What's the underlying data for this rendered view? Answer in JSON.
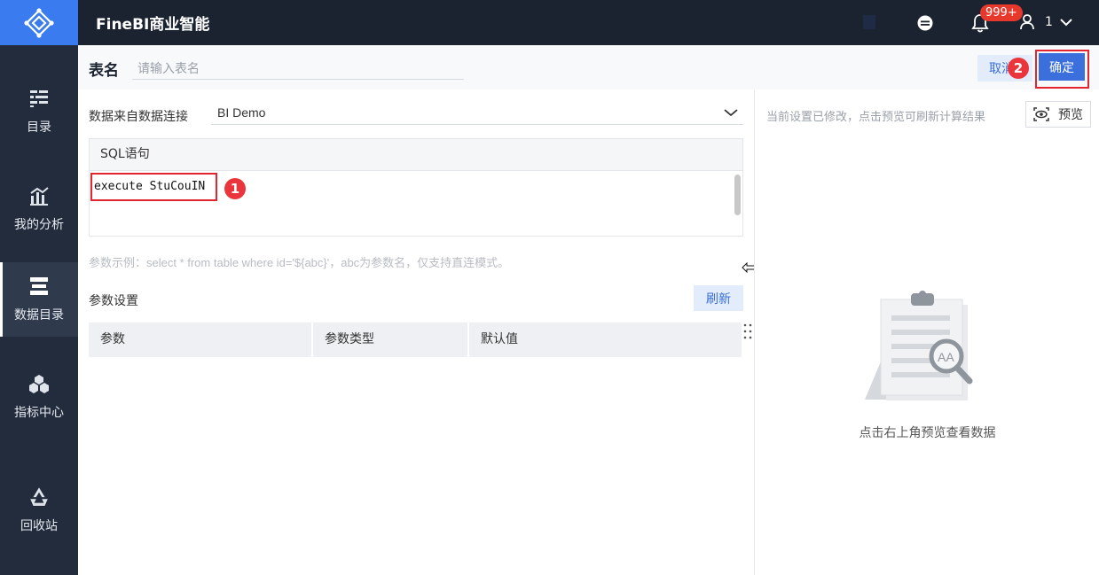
{
  "header": {
    "app_title": "FineBI商业智能",
    "notification_count": "999+",
    "user_name": "1"
  },
  "sidebar": {
    "items": [
      {
        "label": "目录",
        "icon": "list-icon",
        "active": false
      },
      {
        "label": "我的分析",
        "icon": "analysis-chart-icon",
        "active": false
      },
      {
        "label": "数据目录",
        "icon": "database-icon",
        "active": true
      },
      {
        "label": "指标中心",
        "icon": "cubes-icon",
        "active": false
      },
      {
        "label": "回收站",
        "icon": "recycle-icon",
        "active": false
      }
    ]
  },
  "toolbar": {
    "table_name_label": "表名",
    "table_name_placeholder": "请输入表名",
    "table_name_value": "",
    "cancel_label": "取消",
    "confirm_label": "确定"
  },
  "editor": {
    "source_label": "数据来自数据连接",
    "source_value": "BI Demo",
    "sql_header": "SQL语句",
    "sql_text": "execute StuCouIN",
    "param_hint": "参数示例：select * from table where id='${abc}'，abc为参数名，仅支持直连模式。",
    "param_section_label": "参数设置",
    "refresh_label": "刷新",
    "param_columns": [
      "参数",
      "参数类型",
      "默认值"
    ]
  },
  "preview": {
    "note": "当前设置已修改，点击预览可刷新计算结果",
    "preview_label": "预览",
    "empty_text": "点击右上角预览查看数据"
  },
  "annotations": {
    "step1": "1",
    "step2": "2",
    "highlight_color": "#e4242e"
  },
  "colors": {
    "sidebar_bg": "#222c3c",
    "header_bg": "#1b2331",
    "logo_bg": "#3a7bf0",
    "primary_button": "#3a6fdc",
    "secondary_button_bg": "#e3ecfb"
  }
}
